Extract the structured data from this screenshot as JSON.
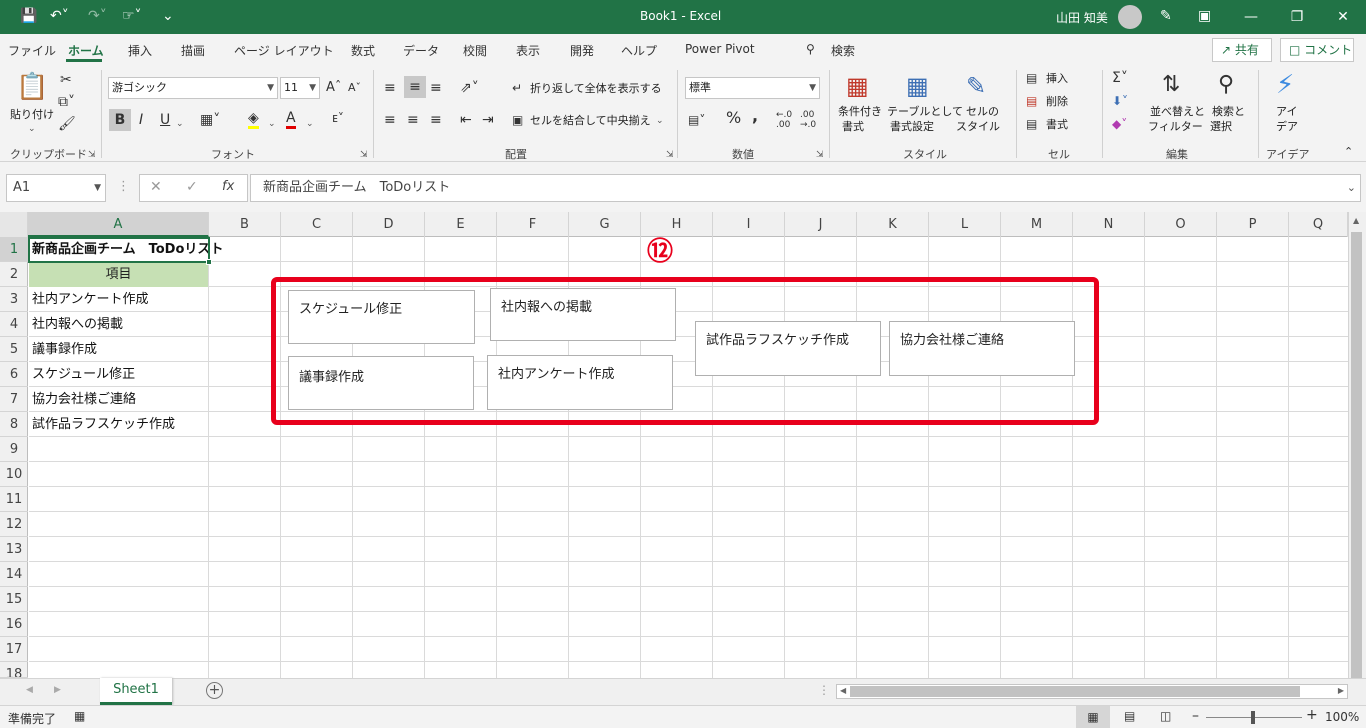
{
  "window": {
    "title": "Book1  -  Excel",
    "user": "山田 知美"
  },
  "tabs": [
    "ファイル",
    "ホーム",
    "挿入",
    "描画",
    "ページ レイアウト",
    "数式",
    "データ",
    "校閲",
    "表示",
    "開発",
    "ヘルプ",
    "Power Pivot",
    "検索"
  ],
  "share_label": "共有",
  "comment_label": "コメント",
  "ribbon": {
    "clipboard": {
      "label": "クリップボード",
      "paste": "貼り付け"
    },
    "font": {
      "label": "フォント",
      "name": "游ゴシック",
      "size": "11",
      "bold": "B",
      "italic": "I",
      "underline": "U"
    },
    "alignment": {
      "label": "配置",
      "wrap": "折り返して全体を表示する",
      "merge": "セルを結合して中央揃え"
    },
    "number": {
      "label": "数値",
      "format": "標準"
    },
    "styles": {
      "label": "スタイル",
      "conditional_1": "条件付き",
      "conditional_2": "書式",
      "table_1": "テーブルとして",
      "table_2": "書式設定",
      "cellstyle_1": "セルの",
      "cellstyle_2": "スタイル"
    },
    "cells": {
      "label": "セル",
      "insert": "挿入",
      "delete": "削除",
      "format": "書式"
    },
    "editing": {
      "label": "編集",
      "sort_1": "並べ替えと",
      "sort_2": "フィルター",
      "find_1": "検索と",
      "find_2": "選択"
    },
    "ideas": {
      "label": "アイデア",
      "btn_1": "アイ",
      "btn_2": "デア"
    }
  },
  "formula_bar": {
    "name_box": "A1",
    "formula": "新商品企画チーム　ToDoリスト"
  },
  "columns": [
    "A",
    "B",
    "C",
    "D",
    "E",
    "F",
    "G",
    "H",
    "I",
    "J",
    "K",
    "L",
    "M",
    "N",
    "O",
    "P",
    "Q"
  ],
  "rows": [
    "1",
    "2",
    "3",
    "4",
    "5",
    "6",
    "7",
    "8",
    "9",
    "10",
    "11",
    "12",
    "13",
    "14",
    "15",
    "16",
    "17",
    "18"
  ],
  "cells": {
    "a1": "新商品企画チーム　ToDoリスト",
    "a2": "項目",
    "a3": "社内アンケート作成",
    "a4": "社内報への掲載",
    "a5": "議事録作成",
    "a6": "スケジュール修正",
    "a7": "協力会社様ご連絡",
    "a8": "試作品ラフスケッチ作成"
  },
  "text_boxes": [
    "スケジュール修正",
    "社内報への掲載",
    "試作品ラフスケッチ作成",
    "協力会社様ご連絡",
    "議事録作成",
    "社内アンケート作成"
  ],
  "annotation_marker": "⑫",
  "sheet_tab": "Sheet1",
  "status": {
    "ready": "準備完了",
    "zoom": "100%"
  },
  "colors": {
    "excel_green": "#217346",
    "highlight_red": "#e8001c",
    "header_fill": "#c6e0b4"
  }
}
